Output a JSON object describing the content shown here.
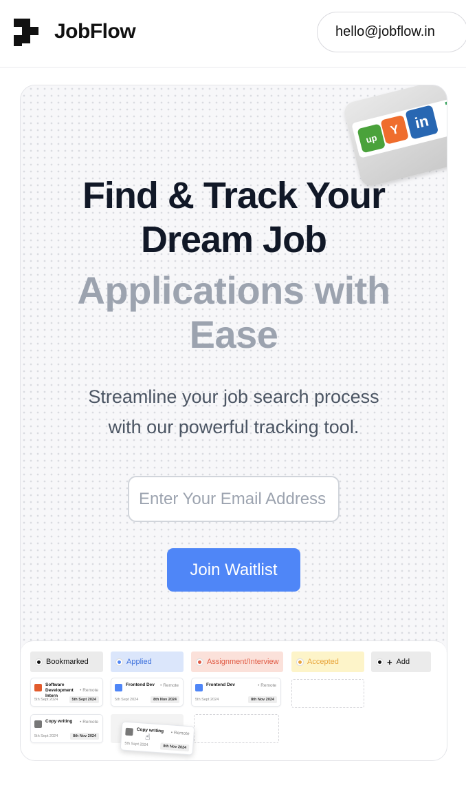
{
  "header": {
    "brand": "JobFlow",
    "contact_email": "hello@jobflow.in"
  },
  "hero": {
    "title_line1": "Find & Track Your",
    "title_line2": "Dream Job",
    "title_gray_line1": "Applications with",
    "title_gray_line2": "Ease",
    "subtitle_line1": "Streamline your job search process",
    "subtitle_line2": "with our powerful tracking tool.",
    "email_placeholder": "Enter Your Email Address",
    "cta_label": "Join Waitlist",
    "logo_chips": [
      "up",
      "Y",
      "in"
    ]
  },
  "board": {
    "columns": [
      {
        "label": "Bookmarked",
        "bg": "#ebebeb",
        "fg": "#111111",
        "dot": "#111111"
      },
      {
        "label": "Applied",
        "bg": "#dbe6fb",
        "fg": "#3b6fdc",
        "dot": "#4f86f7"
      },
      {
        "label": "Assignment/Interview",
        "bg": "#fbe1da",
        "fg": "#e05a44",
        "dot": "#e05a44"
      },
      {
        "label": "Accepted",
        "bg": "#fdf4c9",
        "fg": "#e8a43a",
        "dot": "#e8a43a"
      },
      {
        "label": "Add",
        "bg": "#ebebeb",
        "fg": "#111111",
        "dot": "#111111"
      }
    ],
    "cards": [
      {
        "title": "Software Development Intern",
        "meta": "• Remote",
        "date": "5th Sept 2024",
        "badge": "5th Sept 2024",
        "color": "#e25b2c"
      },
      {
        "title": "Frontend Dev",
        "meta": "• Remote",
        "date": "5th Sept 2024",
        "badge": "8th Nov 2024",
        "color": "#4f86f7"
      },
      {
        "title": "Frontend Dev",
        "meta": "• Remote",
        "date": "5th Sept 2024",
        "badge": "8th Nov 2024",
        "color": "#4f86f7"
      },
      {
        "title": "Copy writing",
        "meta": "• Remote",
        "date": "5th Sept 2024",
        "badge": "8th Nov 2024",
        "color": "#777777"
      },
      {
        "title": "Copy writing",
        "meta": "• Remote",
        "date": "5th Sept 2024",
        "badge": "8th Nov 2024",
        "color": "#777777"
      }
    ]
  }
}
